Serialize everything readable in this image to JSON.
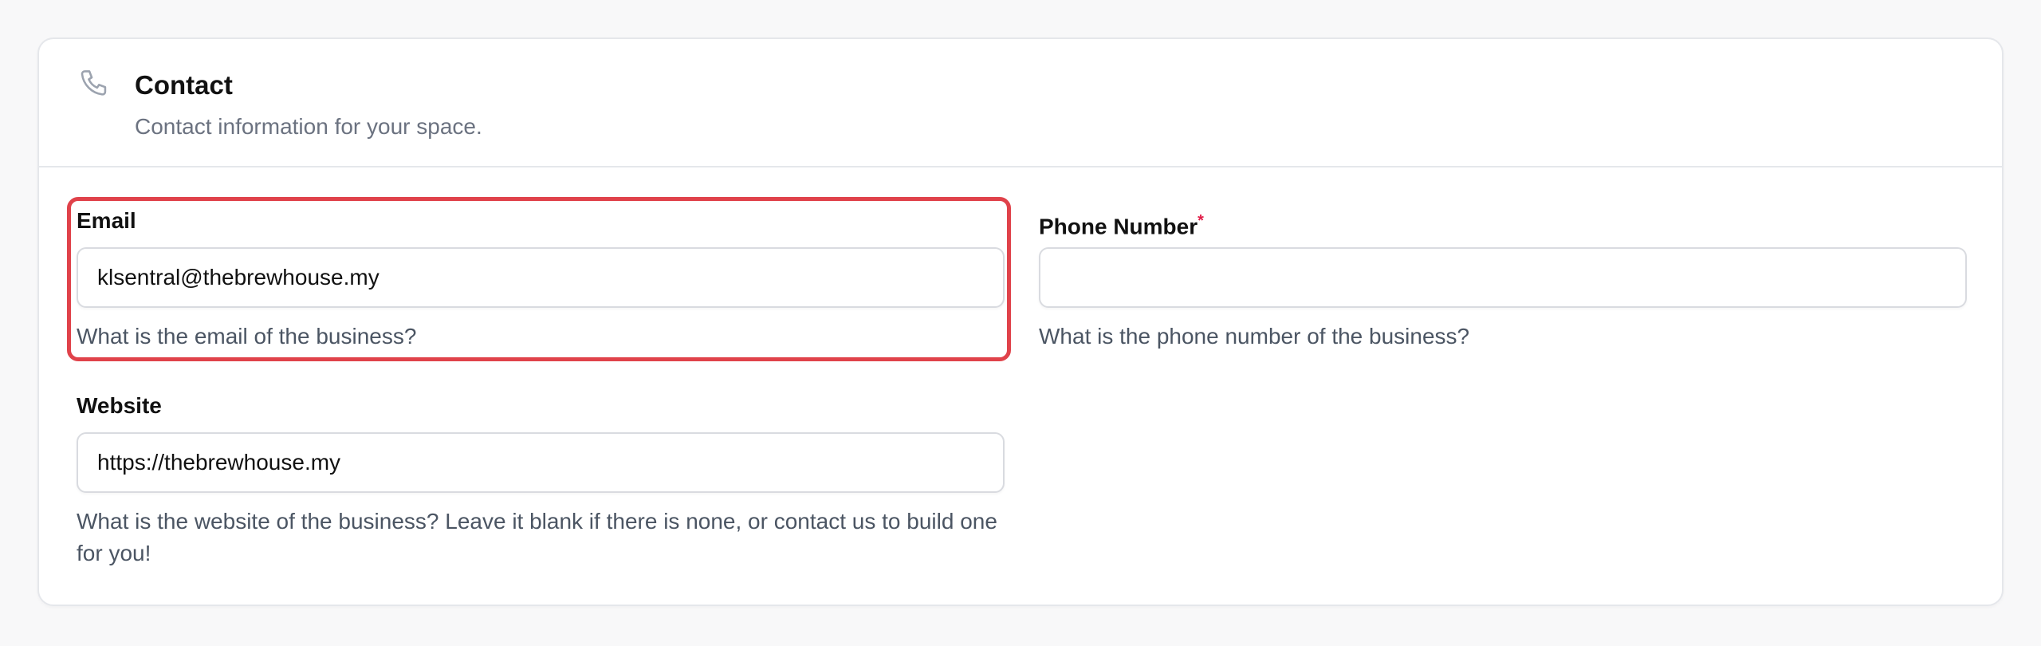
{
  "section": {
    "icon": "phone-icon",
    "title": "Contact",
    "subtitle": "Contact information for your space."
  },
  "fields": {
    "email": {
      "label": "Email",
      "value": "klsentral@thebrewhouse.my",
      "placeholder": "",
      "help": "What is the email of the business?"
    },
    "phone": {
      "label": "Phone Number",
      "required_mark": "*",
      "value": "",
      "placeholder": "",
      "help": "What is the phone number of the business?"
    },
    "website": {
      "label": "Website",
      "value": "https://thebrewhouse.my",
      "placeholder": "",
      "help": "What is the website of the business? Leave it blank if there is none, or contact us to build one for you!"
    }
  },
  "colors": {
    "highlight": "#e0424a",
    "required": "#e11d48",
    "muted_text": "#6b7280",
    "border": "#d9dbe0"
  }
}
